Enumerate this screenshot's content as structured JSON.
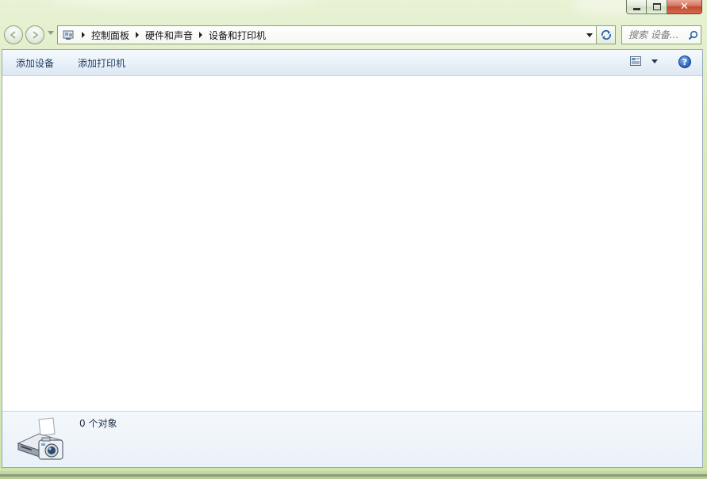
{
  "window": {
    "caption": {
      "minimize_glyph": "–",
      "close_glyph": "✕"
    }
  },
  "navigation": {
    "back_icon": "back-arrow-icon",
    "forward_icon": "forward-arrow-icon"
  },
  "address_bar": {
    "location_icon": "control-panel-icon",
    "breadcrumbs": [
      {
        "label": "控制面板"
      },
      {
        "label": "硬件和声音"
      },
      {
        "label": "设备和打印机"
      }
    ]
  },
  "search": {
    "placeholder": "搜索 设备..."
  },
  "command_bar": {
    "add_device": "添加设备",
    "add_printer": "添加打印机",
    "help_glyph": "?"
  },
  "details_pane": {
    "item_count": "0 个对象",
    "icon": "printer-camera-icon"
  },
  "colors": {
    "frame_accent": "#cfe4ac",
    "command_text": "#1e3b5e",
    "help_blue": "#2f6bc7",
    "close_red": "#c24a32"
  }
}
